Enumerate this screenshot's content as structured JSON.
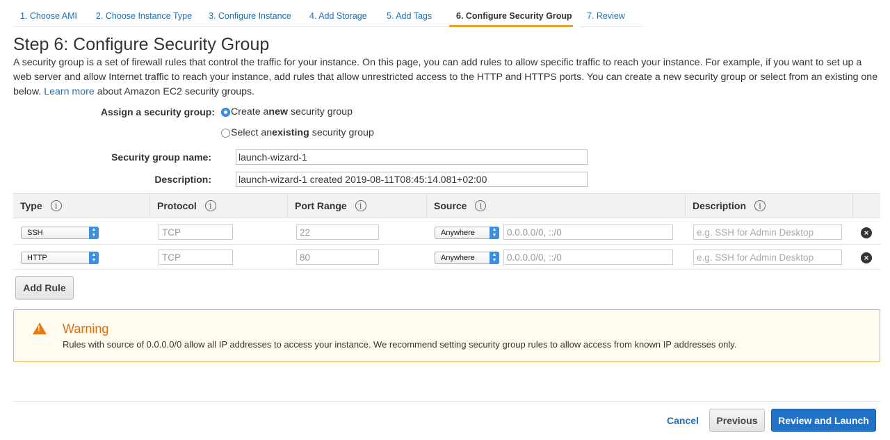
{
  "tabs": [
    {
      "label": "1. Choose AMI"
    },
    {
      "label": "2. Choose Instance Type"
    },
    {
      "label": "3. Configure Instance"
    },
    {
      "label": "4. Add Storage"
    },
    {
      "label": "5. Add Tags"
    },
    {
      "label": "6. Configure Security Group",
      "active": true
    },
    {
      "label": "7. Review"
    }
  ],
  "page_title": "Step 6: Configure Security Group",
  "intro": {
    "text_before_link": "A security group is a set of firewall rules that control the traffic for your instance. On this page, you can add rules to allow specific traffic to reach your instance. For example, if you want to set up a web server and allow Internet traffic to reach your instance, add rules that allow unrestricted access to the HTTP and HTTPS ports. You can create a new security group or select from an existing one below.",
    "link": "Learn more",
    "text_after_link": "about Amazon EC2 security groups."
  },
  "assign": {
    "label": "Assign a security group:",
    "options": [
      {
        "pre": "Create a ",
        "bold": "new",
        "post": " security group",
        "selected": true
      },
      {
        "pre": "Select an ",
        "bold": "existing",
        "post": " security group",
        "selected": false
      }
    ]
  },
  "group_name": {
    "label": "Security group name:",
    "value": "launch-wizard-1"
  },
  "description": {
    "label": "Description:",
    "value": "launch-wizard-1 created 2019-08-11T08:45:14.081+02:00"
  },
  "table": {
    "headers": [
      "Type",
      "Protocol",
      "Port Range",
      "Source",
      "Description"
    ],
    "rows": [
      {
        "type": "SSH",
        "protocol": "TCP",
        "port": "22",
        "source": "Anywhere",
        "cidr": "0.0.0.0/0, ::/0",
        "desc_placeholder": "e.g. SSH for Admin Desktop"
      },
      {
        "type": "HTTP",
        "protocol": "TCP",
        "port": "80",
        "source": "Anywhere",
        "cidr": "0.0.0.0/0, ::/0",
        "desc_placeholder": "e.g. SSH for Admin Desktop"
      }
    ]
  },
  "add_rule": "Add Rule",
  "warning": {
    "title": "Warning",
    "text": "Rules with source of 0.0.0.0/0 allow all IP addresses to access your instance. We recommend setting security group rules to allow access from known IP addresses only."
  },
  "footer": {
    "cancel": "Cancel",
    "previous": "Previous",
    "review": "Review and Launch"
  },
  "colors": {
    "accent": "#1f72c6",
    "tab_active_underline": "#f0a030",
    "warning": "#e57b16"
  }
}
